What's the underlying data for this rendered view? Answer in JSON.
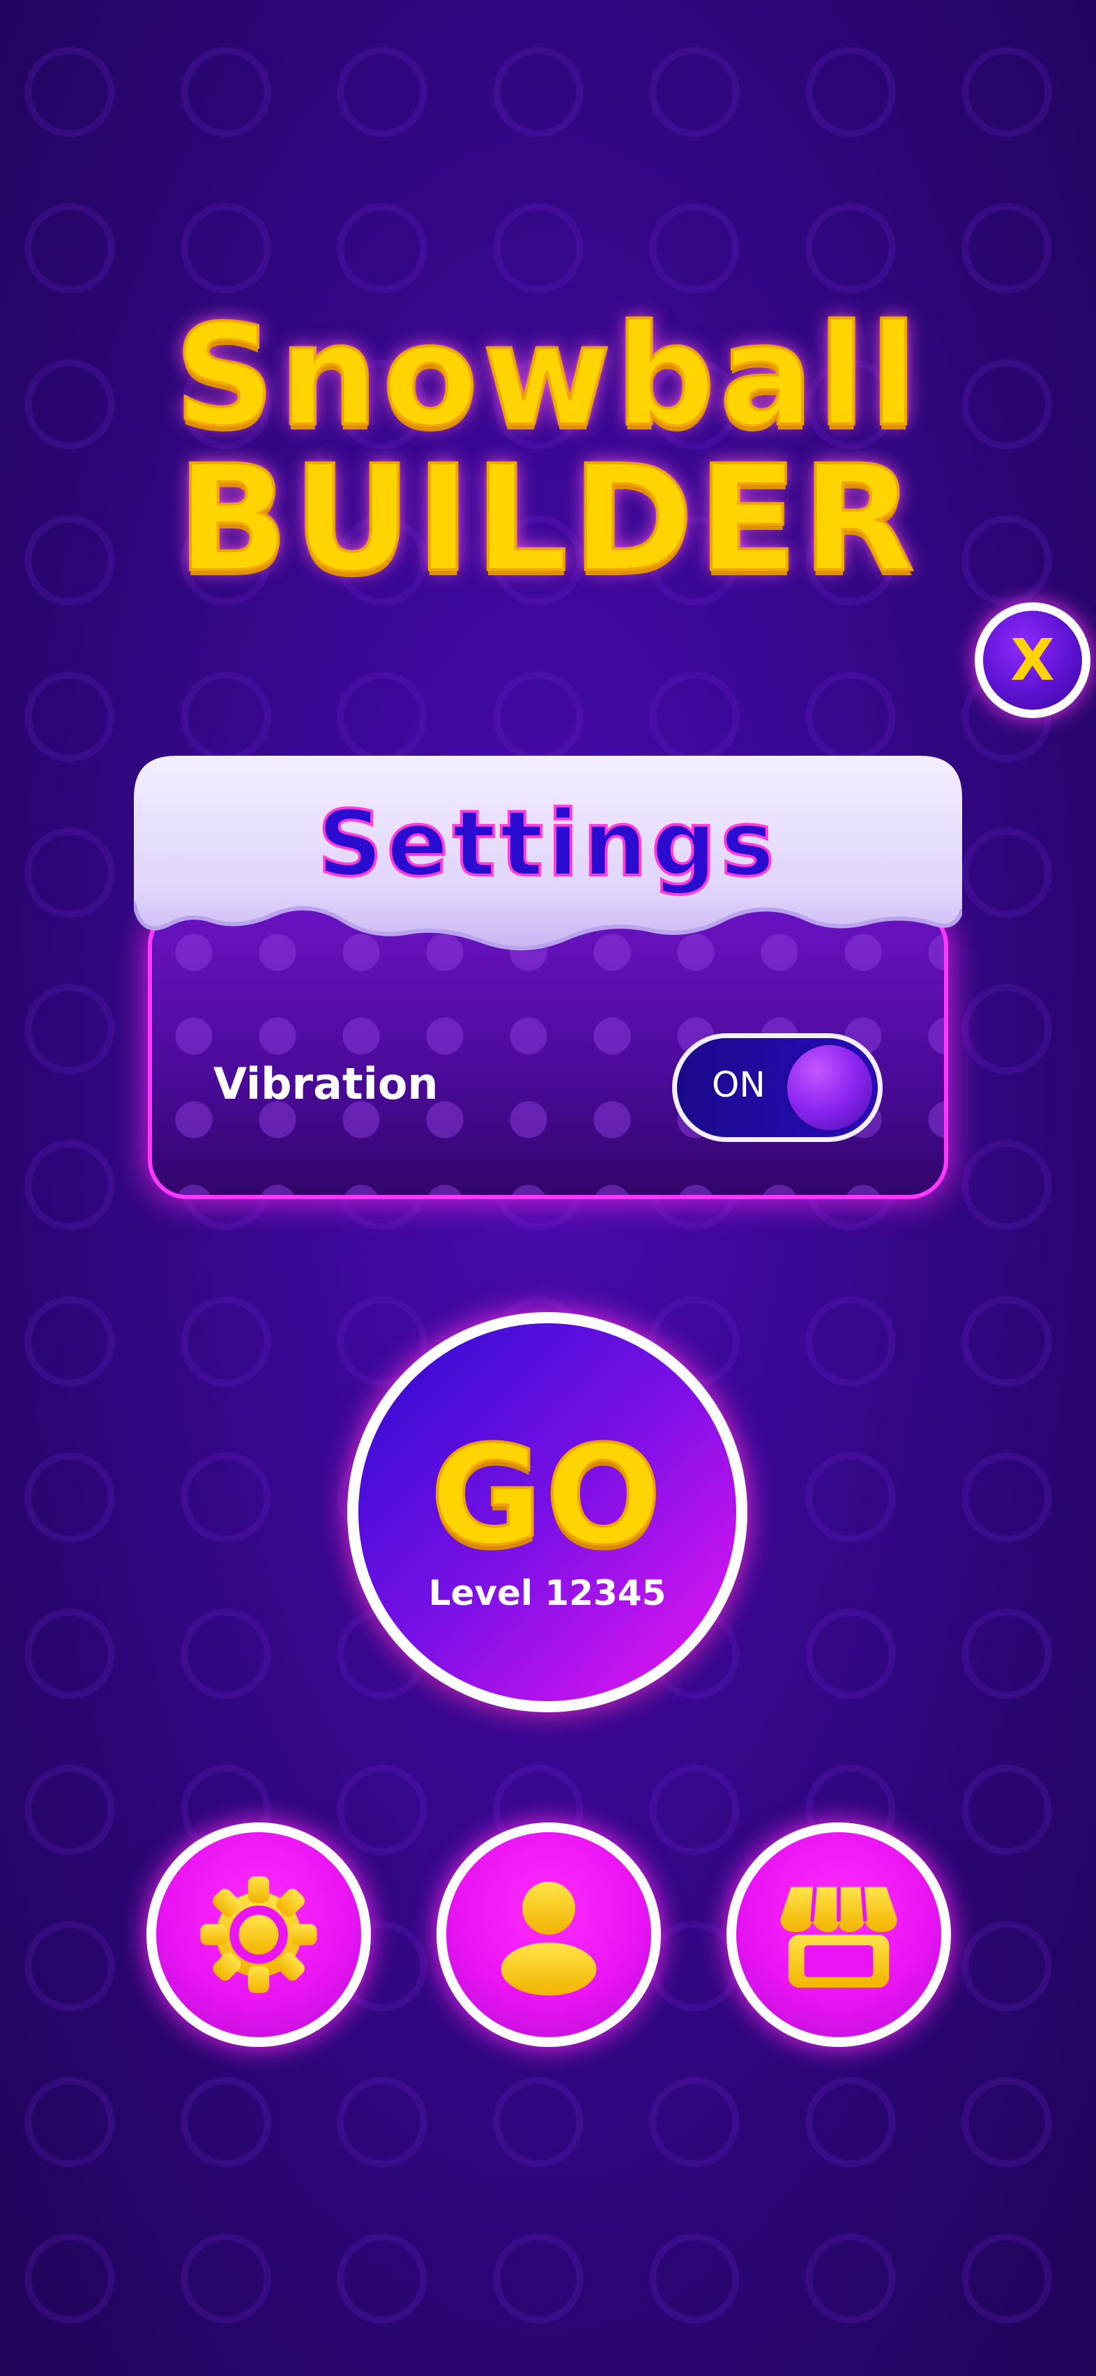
{
  "title": {
    "line1": "Snowball",
    "line2": "BUILDER"
  },
  "close_button": {
    "label": "X"
  },
  "settings_panel": {
    "heading": "Settings",
    "vibration": {
      "label": "Vibration",
      "state": "ON"
    }
  },
  "play": {
    "label": "GO",
    "level_text": "Level 12345"
  },
  "bottom_nav": [
    {
      "icon": "gear-icon"
    },
    {
      "icon": "user-icon"
    },
    {
      "icon": "shop-icon"
    }
  ],
  "colors": {
    "background": "#3a0894",
    "title_yellow": "#ffd400",
    "neon_pink": "#ff38ff",
    "settings_heading": "#2a0bd0",
    "snow": "#eae2ff"
  }
}
